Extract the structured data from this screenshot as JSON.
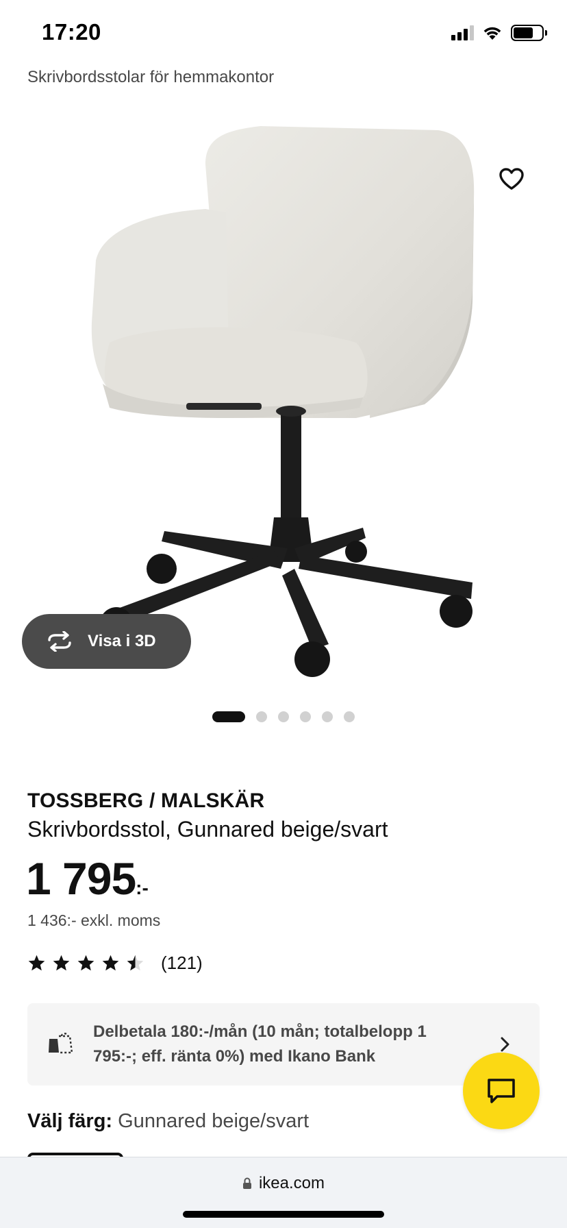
{
  "status_bar": {
    "time": "17:20",
    "battery_level": 0.7
  },
  "breadcrumb": "Skrivbordsstolar för hemmakontor",
  "gallery": {
    "view_3d_label": "Visa i 3D",
    "image_count": 6,
    "active_index": 0
  },
  "product": {
    "name": "TOSSBERG / MALSKÄR",
    "description": "Skrivbordsstol, Gunnared beige/svart",
    "price": "1 795",
    "price_suffix": ":-",
    "price_ex_vat": "1 436:- exkl. moms",
    "rating": 4.5,
    "rating_count": "(121)"
  },
  "finance": {
    "text": "Delbetala 180:-/mån (10 mån; totalbelopp 1 795:-; eff. ränta 0%) med Ikano Bank"
  },
  "color_choice": {
    "label": "Välj färg:",
    "value": "Gunnared beige/svart"
  },
  "browser": {
    "url": "ikea.com"
  },
  "colors": {
    "accent_yellow": "#fbd914",
    "text_dark": "#111111",
    "text_muted": "#484848",
    "pill_dark": "#4b4b4b",
    "finance_bg": "#f5f5f5",
    "browser_bg": "#f1f3f6"
  },
  "icons": {
    "favourite": "heart-icon",
    "rotate": "rotate-3d-icon",
    "finance": "payment-bag-icon",
    "chevron": "chevron-right-icon",
    "chat": "chat-bubble-icon",
    "lock": "lock-icon"
  }
}
